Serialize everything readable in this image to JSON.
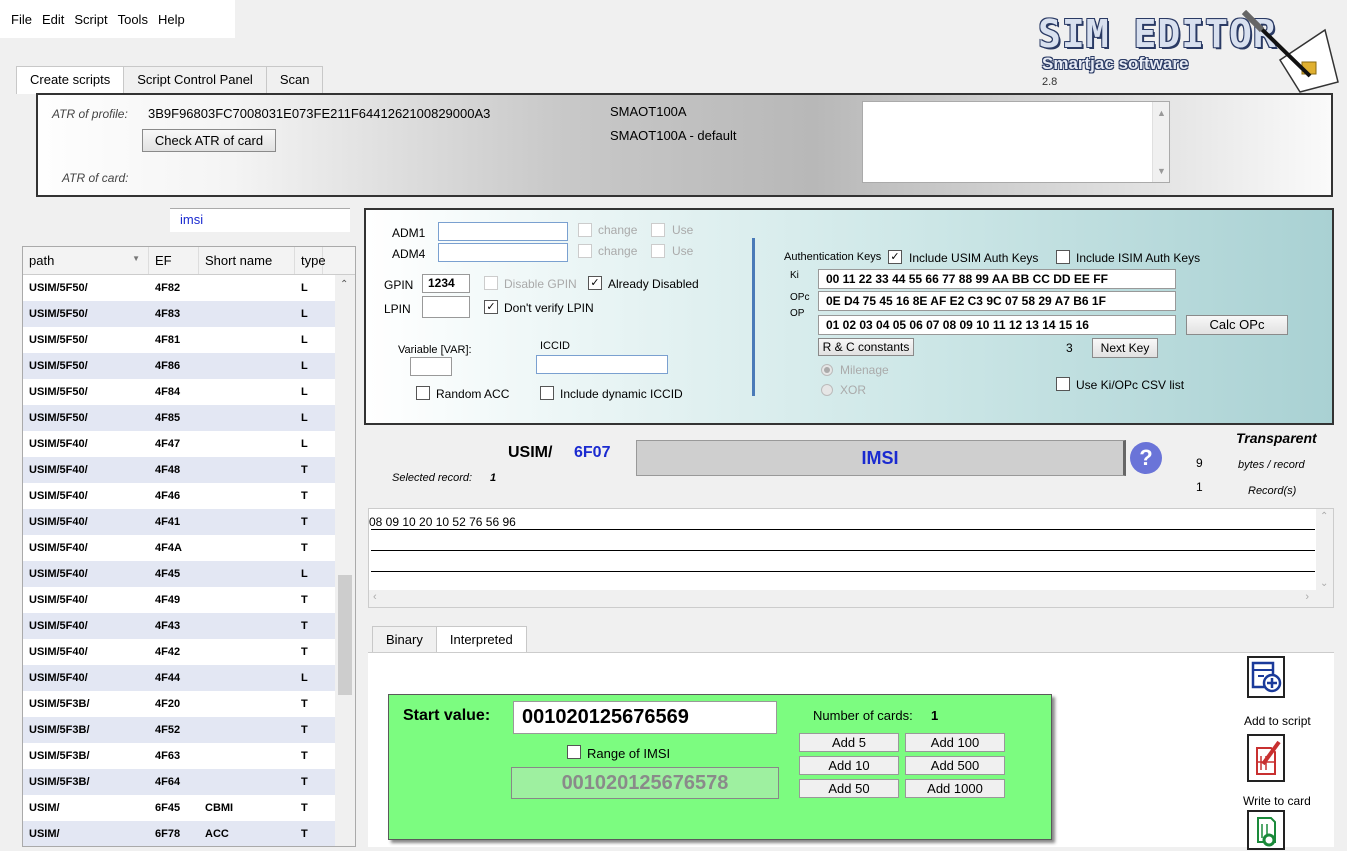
{
  "menu": [
    "File",
    "Edit",
    "Script",
    "Tools",
    "Help"
  ],
  "logo": {
    "title": "SIM EDITOR",
    "subtitle": "Smartjac software",
    "version": "2.8"
  },
  "top_tabs": [
    "Create scripts",
    "Script Control Panel",
    "Scan"
  ],
  "atr": {
    "profile_label": "ATR of profile:",
    "profile_value": "3B9F96803FC7008031E073FE211F6441262100829000A3",
    "card_label": "ATR of card:",
    "check_button": "Check ATR of card",
    "profile_name": "SMAOT100A",
    "profile_default": "SMAOT100A - default"
  },
  "search": {
    "value": "imsi"
  },
  "ef_table": {
    "headers": [
      "path",
      "EF",
      "Short name",
      "type"
    ],
    "rows": [
      [
        "USIM/5F50/",
        "4F82",
        "",
        "L"
      ],
      [
        "USIM/5F50/",
        "4F83",
        "",
        "L"
      ],
      [
        "USIM/5F50/",
        "4F81",
        "",
        "L"
      ],
      [
        "USIM/5F50/",
        "4F86",
        "",
        "L"
      ],
      [
        "USIM/5F50/",
        "4F84",
        "",
        "L"
      ],
      [
        "USIM/5F50/",
        "4F85",
        "",
        "L"
      ],
      [
        "USIM/5F40/",
        "4F47",
        "",
        "L"
      ],
      [
        "USIM/5F40/",
        "4F48",
        "",
        "T"
      ],
      [
        "USIM/5F40/",
        "4F46",
        "",
        "T"
      ],
      [
        "USIM/5F40/",
        "4F41",
        "",
        "T"
      ],
      [
        "USIM/5F40/",
        "4F4A",
        "",
        "T"
      ],
      [
        "USIM/5F40/",
        "4F45",
        "",
        "L"
      ],
      [
        "USIM/5F40/",
        "4F49",
        "",
        "T"
      ],
      [
        "USIM/5F40/",
        "4F43",
        "",
        "T"
      ],
      [
        "USIM/5F40/",
        "4F42",
        "",
        "T"
      ],
      [
        "USIM/5F40/",
        "4F44",
        "",
        "L"
      ],
      [
        "USIM/5F3B/",
        "4F20",
        "",
        "T"
      ],
      [
        "USIM/5F3B/",
        "4F52",
        "",
        "T"
      ],
      [
        "USIM/5F3B/",
        "4F63",
        "",
        "T"
      ],
      [
        "USIM/5F3B/",
        "4F64",
        "",
        "T"
      ],
      [
        "USIM/",
        "6F45",
        "CBMI",
        "T"
      ],
      [
        "USIM/",
        "6F78",
        "ACC",
        "T"
      ]
    ]
  },
  "auth": {
    "adm1_label": "ADM1",
    "adm4_label": "ADM4",
    "change_label": "change",
    "use_label": "Use",
    "gpin_label": "GPIN",
    "gpin_value": "1234",
    "lpin_label": "LPIN",
    "disable_gpin": "Disable GPIN",
    "already_disabled": "Already Disabled",
    "dont_verify_lpin": "Don't verify LPIN",
    "variable_label": "Variable [VAR]:",
    "iccid_label": "ICCID",
    "random_acc": "Random ACC",
    "include_dynamic_iccid": "Include dynamic ICCID",
    "auth_keys_label": "Authentication Keys",
    "include_usim": "Include USIM Auth Keys",
    "include_isim": "Include ISIM Auth Keys",
    "ki_label": "Ki",
    "ki_value": "00 11 22 33 44 55 66 77 88 99 AA BB CC DD EE FF",
    "opc_label": "OPc",
    "opc_value": "0E D4 75 45 16 8E AF E2 C3 9C 07 58 29 A7 B6 1F",
    "op_label": "OP",
    "op_value": "01 02 03 04 05 06 07 08 09 10 11 12 13 14 15 16",
    "calc_opc": "Calc OPc",
    "rc_constants": "R & C constants",
    "next_key_count": "3",
    "next_key": "Next Key",
    "milenage": "Milenage",
    "xor": "XOR",
    "use_ki_opc_csv": "Use  Ki/OPc CSV list"
  },
  "record": {
    "path": "USIM/",
    "ef": "6F07",
    "name": "IMSI",
    "selected_label": "Selected record:",
    "selected_value": "1",
    "structure": "Transparent",
    "bytes": "9",
    "bytes_label": "bytes / record",
    "records": "1",
    "records_label": "Record(s)",
    "data_line": "08 09 10 20 10 52 76 56 96"
  },
  "bottom_tabs": [
    "Binary",
    "Interpreted"
  ],
  "interpreted": {
    "start_label": "Start value:",
    "start_value": "001020125676569",
    "range_label": "Range of IMSI",
    "range_end": "001020125676578",
    "cards_label": "Number of cards:",
    "cards_value": "1",
    "buttons": [
      "Add 5",
      "Add 100",
      "Add 10",
      "Add 500",
      "Add 50",
      "Add 1000"
    ]
  },
  "side_actions": {
    "add_to_script": "Add to script",
    "write_to_card": "Write to card"
  }
}
